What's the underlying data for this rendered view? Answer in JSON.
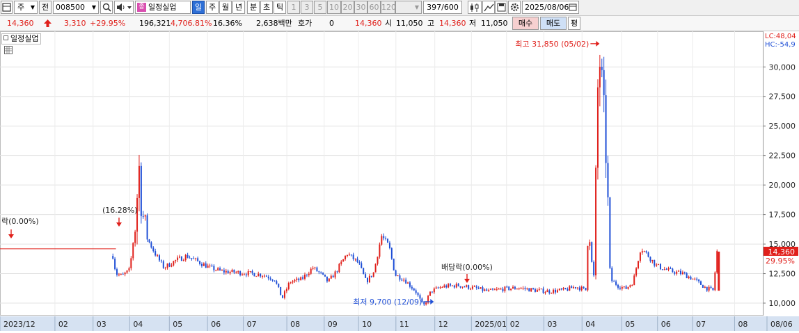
{
  "toolbar": {
    "market_select": "주",
    "prefix_label": "전",
    "code": "008500",
    "stock_name": "일정실업",
    "stock_badge": "종",
    "period_tabs": [
      "일",
      "주",
      "월",
      "년",
      "분",
      "초",
      "틱"
    ],
    "active_period": "일",
    "minute_options": [
      "1",
      "3",
      "5",
      "10",
      "20",
      "30",
      "60",
      "120"
    ],
    "count": "397",
    "count_max": "/600",
    "date": "2025/08/06"
  },
  "info": {
    "price": "14,360",
    "change": "3,310",
    "change_rate": "+29.95%",
    "volume": "196,321",
    "volume_rate": "4,706.81%",
    "turnover": "16.36%",
    "amount": "2,638백만",
    "hoga_label": "호가",
    "hoga_value": "0",
    "hoga_price": "14,360",
    "open_label": "시",
    "open": "11,050",
    "high_label": "고",
    "high": "14,360",
    "low_label": "저",
    "low": "11,050",
    "buy": "매수",
    "sell": "매도",
    "avg": "평"
  },
  "legend": {
    "name": "일정실업"
  },
  "right_info": {
    "lc": "LC:48,04",
    "hc": "HC:-54,9"
  },
  "current_price": {
    "price": "14,360",
    "rate": "29.95%"
  },
  "colors": {
    "up": "#e0201b",
    "down": "#1f4fd6",
    "hline": "#e0201b"
  },
  "chart_data": {
    "type": "candlestick",
    "ylim": [
      9000,
      32900
    ],
    "yticks": [
      10000,
      12500,
      15000,
      17500,
      20000,
      22500,
      25000,
      27500,
      30000
    ],
    "ytick_labels": [
      "10,000",
      "12,500",
      "15,000",
      "17,500",
      "20,000",
      "22,500",
      "25,000",
      "27,500",
      "30,000"
    ],
    "x_labels": [
      "2023/12",
      "02",
      "03",
      "04",
      "05",
      "06",
      "07",
      "08",
      "09",
      "10",
      "11",
      "12",
      "2025/01",
      "02",
      "03",
      "04",
      "05",
      "06",
      "07",
      "08",
      "08/06"
    ],
    "annotations": [
      {
        "text": "락(0.00%)"
      },
      {
        "text": "(16.28%)"
      },
      {
        "text": "최고 31,850 (05/02)",
        "value": 31850
      },
      {
        "text": "최저 9,700 (12/09)",
        "value": 9700
      },
      {
        "text": "배당락(0.00%)"
      }
    ],
    "series": [
      {
        "t": 0.0,
        "v": 14600
      },
      {
        "t": 0.14,
        "v": 14600
      },
      {
        "t": 0.148,
        "v": 14000
      },
      {
        "t": 0.152,
        "v": 12500
      },
      {
        "t": 0.16,
        "v": 12300
      },
      {
        "t": 0.17,
        "v": 12800
      },
      {
        "t": 0.178,
        "v": 17000
      },
      {
        "t": 0.182,
        "v": 21800
      },
      {
        "t": 0.186,
        "v": 18000
      },
      {
        "t": 0.192,
        "v": 15600
      },
      {
        "t": 0.205,
        "v": 14000
      },
      {
        "t": 0.215,
        "v": 13000
      },
      {
        "t": 0.23,
        "v": 13600
      },
      {
        "t": 0.245,
        "v": 14000
      },
      {
        "t": 0.26,
        "v": 13500
      },
      {
        "t": 0.275,
        "v": 13000
      },
      {
        "t": 0.29,
        "v": 12700
      },
      {
        "t": 0.31,
        "v": 12600
      },
      {
        "t": 0.33,
        "v": 12500
      },
      {
        "t": 0.345,
        "v": 12400
      },
      {
        "t": 0.36,
        "v": 12000
      },
      {
        "t": 0.37,
        "v": 10400
      },
      {
        "t": 0.38,
        "v": 11800
      },
      {
        "t": 0.395,
        "v": 12000
      },
      {
        "t": 0.41,
        "v": 13000
      },
      {
        "t": 0.42,
        "v": 12500
      },
      {
        "t": 0.43,
        "v": 11800
      },
      {
        "t": 0.44,
        "v": 12600
      },
      {
        "t": 0.455,
        "v": 14200
      },
      {
        "t": 0.47,
        "v": 13400
      },
      {
        "t": 0.48,
        "v": 11800
      },
      {
        "t": 0.49,
        "v": 12600
      },
      {
        "t": 0.5,
        "v": 15700
      },
      {
        "t": 0.51,
        "v": 14800
      },
      {
        "t": 0.518,
        "v": 12400
      },
      {
        "t": 0.53,
        "v": 12000
      },
      {
        "t": 0.545,
        "v": 11000
      },
      {
        "t": 0.555,
        "v": 9700
      },
      {
        "t": 0.565,
        "v": 11000
      },
      {
        "t": 0.58,
        "v": 11400
      },
      {
        "t": 0.6,
        "v": 11500
      },
      {
        "t": 0.62,
        "v": 11300
      },
      {
        "t": 0.64,
        "v": 11000
      },
      {
        "t": 0.66,
        "v": 11200
      },
      {
        "t": 0.68,
        "v": 11300
      },
      {
        "t": 0.7,
        "v": 11100
      },
      {
        "t": 0.72,
        "v": 11000
      },
      {
        "t": 0.74,
        "v": 11100
      },
      {
        "t": 0.755,
        "v": 11400
      },
      {
        "t": 0.768,
        "v": 11100
      },
      {
        "t": 0.772,
        "v": 17500
      },
      {
        "t": 0.778,
        "v": 11000
      },
      {
        "t": 0.785,
        "v": 31850
      },
      {
        "t": 0.79,
        "v": 27000
      },
      {
        "t": 0.795,
        "v": 22300
      },
      {
        "t": 0.8,
        "v": 12000
      },
      {
        "t": 0.81,
        "v": 11500
      },
      {
        "t": 0.82,
        "v": 11200
      },
      {
        "t": 0.83,
        "v": 11800
      },
      {
        "t": 0.84,
        "v": 14700
      },
      {
        "t": 0.85,
        "v": 14000
      },
      {
        "t": 0.86,
        "v": 13200
      },
      {
        "t": 0.87,
        "v": 12900
      },
      {
        "t": 0.88,
        "v": 12700
      },
      {
        "t": 0.895,
        "v": 12500
      },
      {
        "t": 0.91,
        "v": 12000
      },
      {
        "t": 0.925,
        "v": 11300
      },
      {
        "t": 0.935,
        "v": 11050
      },
      {
        "t": 0.94,
        "v": 14360
      }
    ]
  }
}
